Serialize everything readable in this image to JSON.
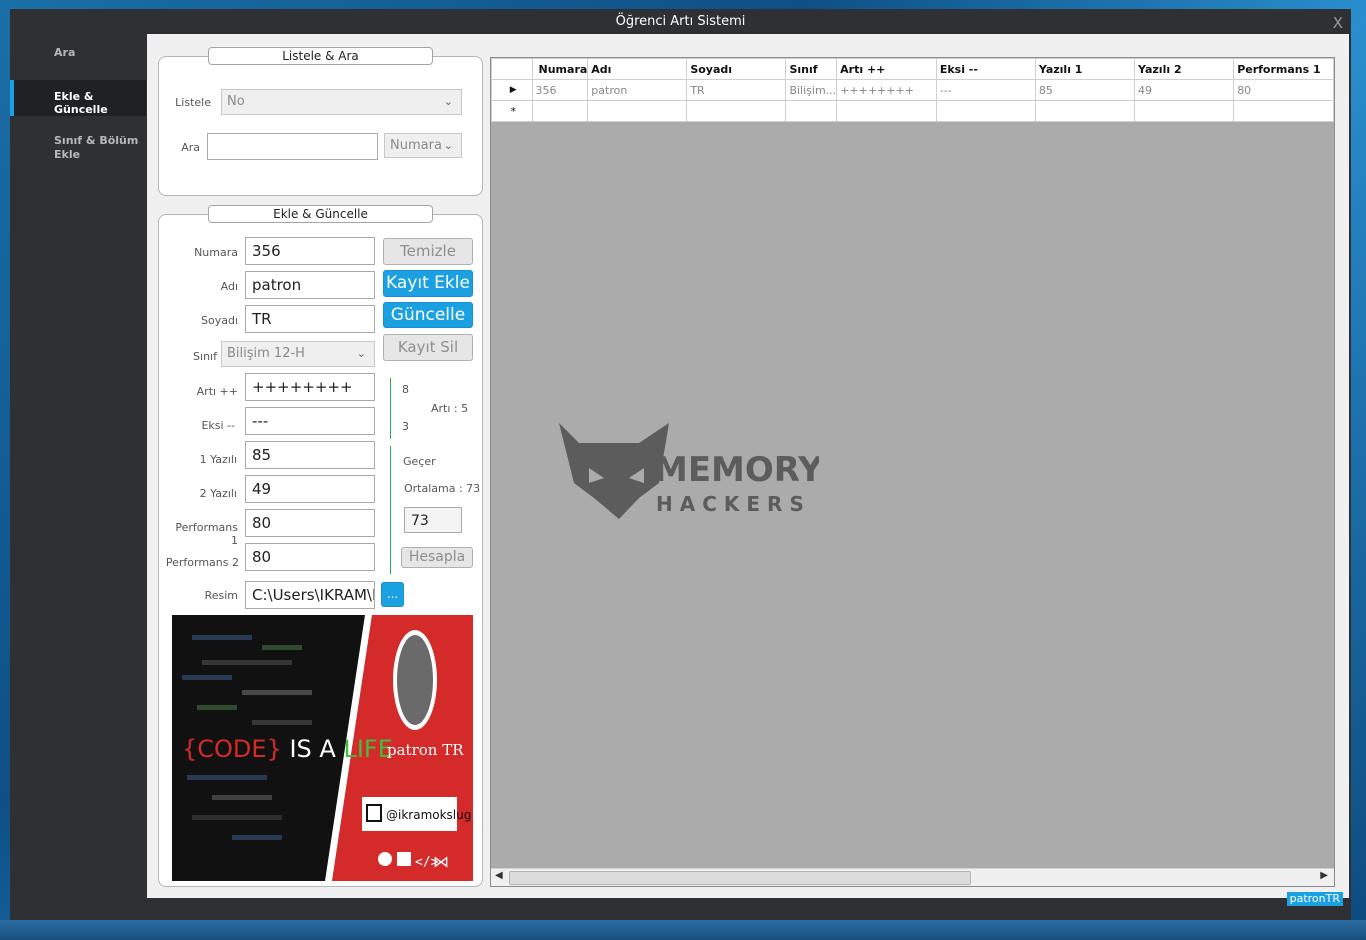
{
  "window": {
    "title": "Öğrenci Artı Sistemi",
    "close_label": "X",
    "status_tag": "patronTR"
  },
  "sidebar": {
    "items": [
      {
        "label": "Ara"
      },
      {
        "label": "Ekle & Güncelle"
      },
      {
        "label": "Sınıf & Bölüm Ekle"
      }
    ]
  },
  "search_group": {
    "title": "Listele & Ara",
    "listele_label": "Listele",
    "listele_value": "No",
    "ara_label": "Ara",
    "ara_value": "",
    "ara_field_value": "Numara"
  },
  "edit_group": {
    "title": "Ekle & Güncelle",
    "fields": {
      "numara": {
        "label": "Numara",
        "value": "356"
      },
      "adi": {
        "label": "Adı",
        "value": "patron"
      },
      "soyadi": {
        "label": "Soyadı",
        "value": "TR"
      },
      "sinif": {
        "label": "Sınıf",
        "value": "Bilişim 12-H"
      },
      "arti": {
        "label": "Artı ++",
        "value": "++++++++"
      },
      "eksi": {
        "label": "Eksi --",
        "value": "---"
      },
      "yazili1": {
        "label": "1 Yazılı",
        "value": "85"
      },
      "yazili2": {
        "label": "2 Yazılı",
        "value": "49"
      },
      "perf1": {
        "label": "Performans 1",
        "value": "80"
      },
      "perf2": {
        "label": "Performans 2",
        "value": "80"
      },
      "resim": {
        "label": "Resim",
        "value": "C:\\Users\\IKRAM\\D"
      }
    },
    "buttons": {
      "temizle": "Temizle",
      "kayit_ekle": "Kayıt Ekle",
      "guncelle": "Güncelle",
      "kayit_sil": "Kayıt Sil",
      "hesapla": "Hesapla",
      "browse": "..."
    },
    "stats": {
      "arti_count": "8",
      "eksi_count": "3",
      "arti_summary": "Artı : 5",
      "status": "Geçer",
      "ortalama": "Ortalama : 73",
      "average_value": "73"
    }
  },
  "promo": {
    "headline_a": "{CODE}",
    "headline_b": " IS A ",
    "headline_c": "LIFE",
    "signature": "patron TR",
    "handle": "@ikramokslug"
  },
  "grid": {
    "columns": [
      "",
      "Numara",
      "Adı",
      "Soyadı",
      "Sınıf",
      "Artı ++",
      "Eksi --",
      "Yazılı 1",
      "Yazılı 2",
      "Performans 1"
    ],
    "rows": [
      [
        "▶",
        "356",
        "patron",
        "TR",
        "Bilişim...",
        "++++++++",
        "---",
        "85",
        "49",
        "80"
      ],
      [
        "*",
        "",
        "",
        "",
        "",
        "",
        "",
        "",
        "",
        ""
      ]
    ]
  },
  "watermark": {
    "line1": "MEMORY",
    "line2": "HACKERS"
  },
  "colors": {
    "accent": "#1ba1e2",
    "sidebar": "#2e3033",
    "promo_red": "#d42a2a"
  }
}
